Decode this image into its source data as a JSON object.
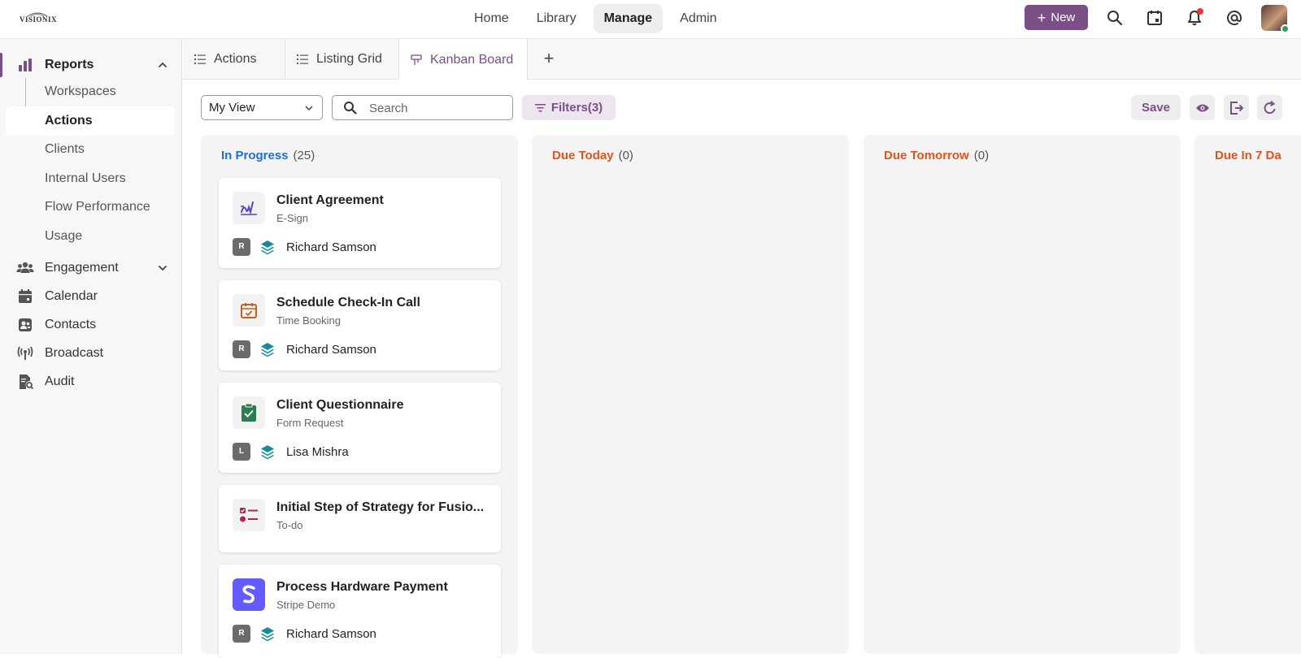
{
  "brand": {
    "logo_text": "VISIONIX"
  },
  "topnav": {
    "items": [
      {
        "label": "Home"
      },
      {
        "label": "Library"
      },
      {
        "label": "Manage",
        "active": true
      },
      {
        "label": "Admin"
      }
    ],
    "new_button": "New",
    "icons": [
      "search-icon",
      "calendar-check-icon",
      "bell-icon",
      "at-icon"
    ],
    "accent_color": "#7a4f86"
  },
  "sidebar": {
    "reports": "Reports",
    "reports_children": [
      "Workspaces",
      "Actions",
      "Clients",
      "Internal Users",
      "Flow Performance",
      "Usage"
    ],
    "active_child": "Actions",
    "engagement": "Engagement",
    "calendar": "Calendar",
    "contacts": "Contacts",
    "broadcast": "Broadcast",
    "audit": "Audit"
  },
  "tabs": [
    {
      "label": "Actions",
      "icon": "list-icon"
    },
    {
      "label": "Listing Grid",
      "icon": "list-icon"
    },
    {
      "label": "Kanban Board",
      "icon": "kanban-icon",
      "active": true
    }
  ],
  "toolbar": {
    "view": "My View",
    "search_placeholder": "Search",
    "filters": "Filters(3)",
    "save": "Save"
  },
  "board": {
    "columns": [
      {
        "title": "In Progress",
        "count": "(25)",
        "color": "#1e6fd0"
      },
      {
        "title": "Due Today",
        "count": "(0)",
        "color": "#e0541e"
      },
      {
        "title": "Due Tomorrow",
        "count": "(0)",
        "color": "#e0541e"
      },
      {
        "title": "Due In 7 Da",
        "count": "",
        "color": "#e0541e"
      }
    ],
    "cards": [
      {
        "title": "Client Agreement",
        "type": "E-Sign",
        "initial": "R",
        "assignee": "Richard Samson",
        "icon": "signature-icon"
      },
      {
        "title": "Schedule Check-In Call",
        "type": "Time Booking",
        "initial": "R",
        "assignee": "Richard Samson",
        "icon": "calendar-booking-icon"
      },
      {
        "title": "Client Questionnaire",
        "type": "Form Request",
        "initial": "L",
        "assignee": "Lisa Mishra",
        "icon": "clipboard-icon"
      },
      {
        "title": "Initial Step of Strategy for Fusio...",
        "type": "To-do",
        "icon": "todo-list-icon"
      },
      {
        "title": "Process Hardware Payment",
        "type": "Stripe Demo",
        "initial": "R",
        "assignee": "Richard Samson",
        "icon": "stripe-icon"
      }
    ]
  }
}
